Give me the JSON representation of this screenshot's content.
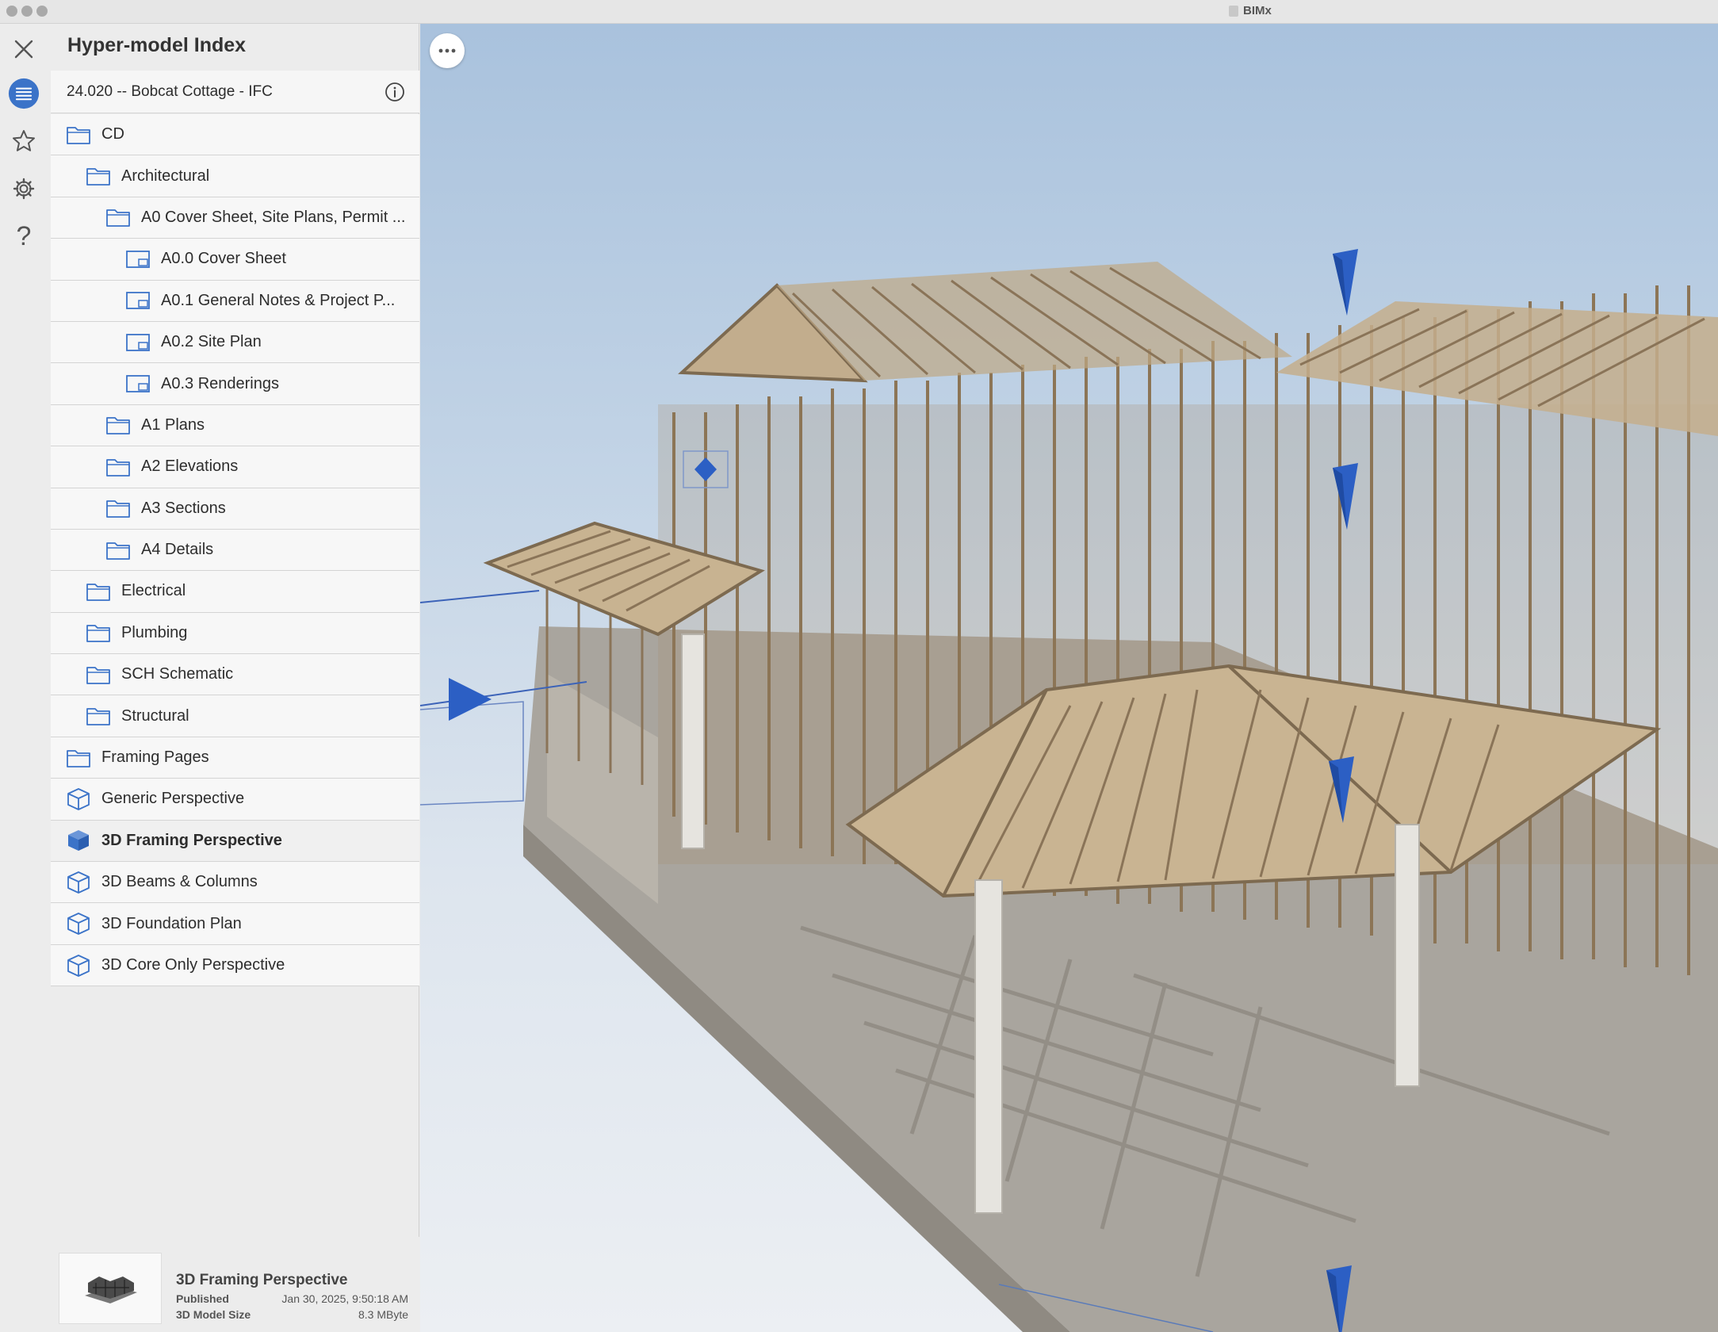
{
  "window": {
    "title": "BIMx"
  },
  "rail": {
    "icons": [
      "close-icon",
      "list-icon",
      "star-icon",
      "gear-icon",
      "help-icon"
    ],
    "help_glyph": "?",
    "accent": "#3b73c8"
  },
  "sidebar": {
    "title": "Hyper-model Index",
    "project": "24.020 -- Bobcat Cottage - IFC",
    "items": [
      {
        "label": "CD",
        "icon": "folder-icon"
      },
      {
        "label": "Architectural",
        "icon": "folder-icon"
      },
      {
        "label": "A0 Cover Sheet, Site Plans, Permit ...",
        "icon": "folder-icon"
      },
      {
        "label": "A0.0 Cover Sheet",
        "icon": "sheet-icon"
      },
      {
        "label": "A0.1 General Notes & Project P...",
        "icon": "sheet-icon"
      },
      {
        "label": "A0.2 Site Plan",
        "icon": "sheet-icon"
      },
      {
        "label": "A0.3 Renderings",
        "icon": "sheet-icon"
      },
      {
        "label": "A1 Plans",
        "icon": "folder-icon"
      },
      {
        "label": "A2 Elevations",
        "icon": "folder-icon"
      },
      {
        "label": "A3 Sections",
        "icon": "folder-icon"
      },
      {
        "label": "A4 Details",
        "icon": "folder-icon"
      },
      {
        "label": "Electrical",
        "icon": "folder-icon"
      },
      {
        "label": "Plumbing",
        "icon": "folder-icon"
      },
      {
        "label": "SCH Schematic",
        "icon": "folder-icon"
      },
      {
        "label": "Structural",
        "icon": "folder-icon"
      },
      {
        "label": "Framing Pages",
        "icon": "folder-icon"
      },
      {
        "label": "Generic Perspective",
        "icon": "cube-icon"
      },
      {
        "label": "3D Framing Perspective",
        "icon": "cube-filled-icon"
      },
      {
        "label": "3D Beams & Columns",
        "icon": "cube-icon"
      },
      {
        "label": "3D Foundation Plan",
        "icon": "cube-icon"
      },
      {
        "label": "3D Core Only Perspective",
        "icon": "cube-icon"
      }
    ],
    "footer": {
      "title": "3D Framing Perspective",
      "published_label": "Published",
      "published_value": "Jan 30, 2025, 9:50:18 AM",
      "size_label": "3D Model Size",
      "size_value": "8.3 MByte"
    }
  },
  "viewport": {
    "more_icon": "more-horizontal-icon",
    "model": "house-framing-3d-model",
    "markers": [
      "section-marker-icon",
      "camera-marker-icon",
      "elevation-marker-icon"
    ],
    "marker_color": "#2c5fc4",
    "wood_color": "#b8a386",
    "concrete_color": "#a39e95"
  }
}
